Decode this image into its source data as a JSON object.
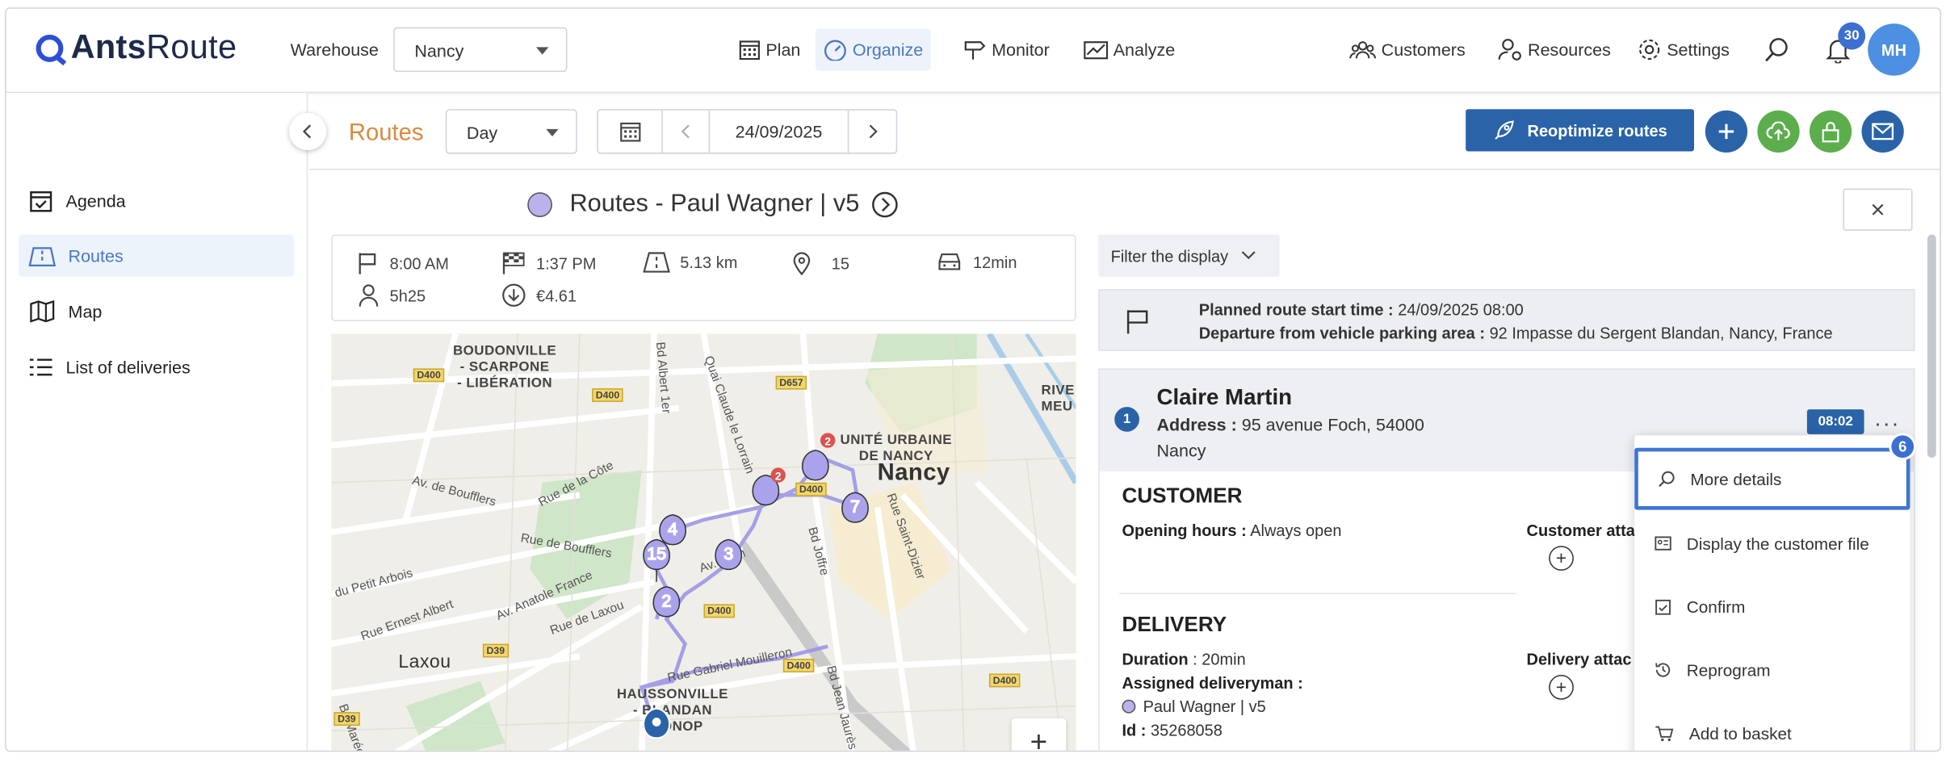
{
  "header": {
    "logo_bold": "Ants",
    "logo_light": "Route",
    "warehouse_label": "Warehouse",
    "warehouse_value": "Nancy",
    "nav": [
      "Plan",
      "Organize",
      "Monitor",
      "Analyze"
    ],
    "right_nav": [
      "Customers",
      "Resources",
      "Settings"
    ],
    "notifications_count": "30",
    "user_initials": "MH"
  },
  "sidebar": {
    "items": [
      {
        "label": "Agenda",
        "icon": "calendar-check-icon"
      },
      {
        "label": "Routes",
        "icon": "map-fold-icon"
      },
      {
        "label": "Map",
        "icon": "map-icon"
      },
      {
        "label": "List of deliveries",
        "icon": "list-icon"
      }
    ]
  },
  "subbar": {
    "title": "Routes",
    "view_mode": "Day",
    "date": "24/09/2025",
    "reoptimize_label": "Reoptimize routes"
  },
  "route": {
    "title": "Routes - Paul Wagner | v5",
    "color": "#b9b2ec"
  },
  "stats": {
    "start_time": "8:00 AM",
    "end_time": "1:37 PM",
    "distance": "5.13 km",
    "stops": "15",
    "drive_time": "12min",
    "total_duration": "5h25",
    "cost": "€4.61"
  },
  "map": {
    "areas": [
      {
        "text": "BOUDONVILLE\n- SCARPONE\n- LIBÉRATION"
      },
      {
        "text": "UNITÉ URBAINE\nDE NANCY"
      },
      {
        "text": "Nancy"
      },
      {
        "text": "HAUSSONVILLE\n- BLANDAN\n- DONOP"
      },
      {
        "text": "Laxou"
      },
      {
        "text": "RIVE\nMEU"
      }
    ],
    "roads": [
      "Bd Albert 1er",
      "Quai Claude le Lorrain",
      "Rue de la Côte",
      "Av. de Boufflers",
      "Rue de Boufflers",
      "du Petit Arbois",
      "Av. Anatole France",
      "Rue de Laxou",
      "Rue Ernest Albert",
      "Rue Gabriel Mouilleron",
      "Bd Joffre",
      "Rue Saint-Dizier",
      "Bd Jean Jaurès",
      "Bd Maréchal",
      "Av. Foch"
    ],
    "shields": [
      "D400",
      "D400",
      "D657",
      "D400",
      "D400",
      "D400",
      "D39",
      "D400",
      "D39"
    ],
    "markers": [
      "15",
      "4",
      "3",
      "2",
      "7",
      "2",
      "2"
    ],
    "zoom_in": "+"
  },
  "panel": {
    "filter_label": "Filter the display",
    "planned_label": "Planned route start time :",
    "planned_value": "24/09/2025 08:00",
    "departure_label": "Departure from vehicle parking area :",
    "departure_value": "92 Impasse du Sergent Blandan, Nancy, France",
    "stop": {
      "number": "1",
      "name": "Claire Martin",
      "address_label": "Address :",
      "address_value": "95 avenue Foch, 54000",
      "city": "Nancy",
      "time": "08:02"
    },
    "customer": {
      "title": "CUSTOMER",
      "opening_label": "Opening hours :",
      "opening_value": "Always open",
      "attach_label": "Customer atta"
    },
    "delivery": {
      "title": "DELIVERY",
      "duration_label": "Duration",
      "duration_value": ": 20min",
      "assigned_label": "Assigned deliveryman :",
      "assigned_value": "Paul Wagner | v5",
      "id_label": "Id :",
      "id_value": "35268058",
      "attach_label": "Delivery attac"
    }
  },
  "menu": {
    "badge": "6",
    "items": [
      "More details",
      "Display the customer file",
      "Confirm",
      "Reprogram",
      "Add to basket"
    ]
  }
}
